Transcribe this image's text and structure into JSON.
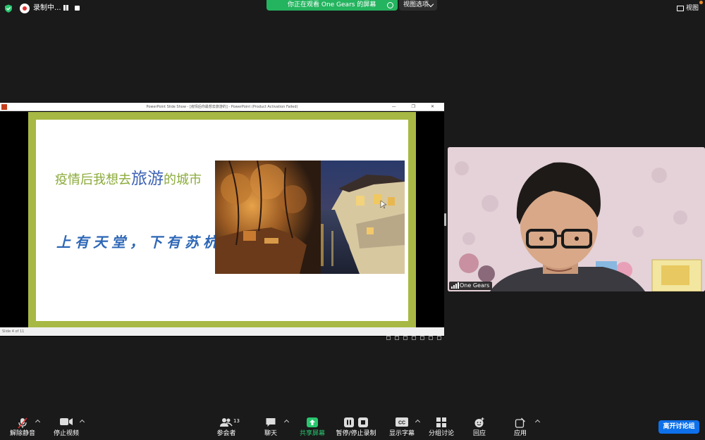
{
  "top_bar": {
    "recording_label": "录制中...",
    "share_banner": "你正在观看 One Gears 的屏幕",
    "view_options": "视图选项",
    "view_button": "视图"
  },
  "ppt": {
    "window_title": "PowerPoint Slide Show - [疫情后你最想去旅游的] - PowerPoint (Product Activation Failed)",
    "window_controls": "— ❐ ✕",
    "slide_counter": "Slide 4 of 11",
    "slide": {
      "title_before": "疫情后我想去",
      "title_highlight": "旅游",
      "title_after": "的城市",
      "poem": "上有天堂，下有苏杭",
      "photo_subject": "night-canal-town-photo"
    }
  },
  "participant": {
    "name": "One Gears"
  },
  "toolbar": {
    "unmute": "解除静音",
    "stop_video": "停止视频",
    "participants": "参会者",
    "participants_count": "13",
    "chat": "聊天",
    "share_screen": "共享屏幕",
    "pause_stop_recording": "暂停/停止录制",
    "captions": "显示字幕",
    "captions_icon_text": "CC",
    "breakout": "分组讨论",
    "reactions": "回应",
    "apps": "应用",
    "leave": "离开讨论组"
  },
  "colors": {
    "share_banner": "#24b35f",
    "leave_button": "#0e71eb",
    "slide_border": "#a8b844",
    "title_green": "#8bab3a",
    "title_blue": "#3d62b5"
  }
}
